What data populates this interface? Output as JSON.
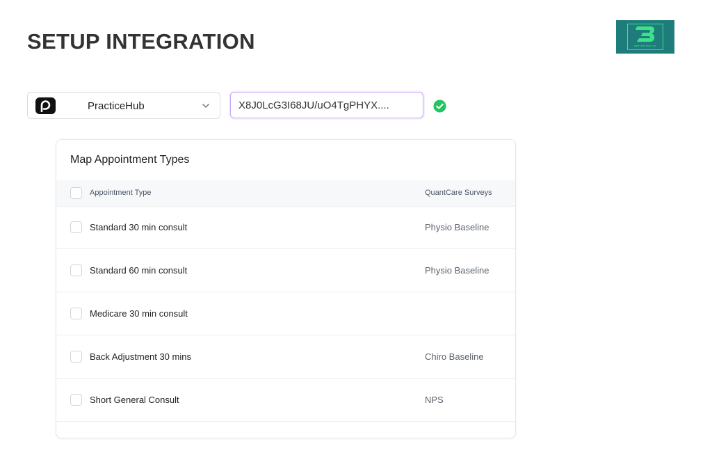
{
  "page": {
    "title": "SETUP INTEGRATION"
  },
  "brand": {
    "logo_text": "BETTER HEALTH",
    "colors": {
      "background": "#1e7c7a",
      "accent": "#3ee08f"
    }
  },
  "integration": {
    "selected_source": "PracticeHub",
    "source_icon": "practicehub-logo-icon",
    "api_key_value": "X8J0LcG3I68JU/uO4TgPHYX....",
    "status_icon": "check-circle-icon",
    "status_color": "#22c55e",
    "input_focus_color": "#c9a7f5"
  },
  "mapping": {
    "title": "Map Appointment Types",
    "columns": {
      "appointment_type": "Appointment Type",
      "survey": "QuantCare Surveys"
    },
    "rows": [
      {
        "appointment_type": "Standard 30 min consult",
        "survey": "Physio Baseline"
      },
      {
        "appointment_type": "Standard 60 min consult",
        "survey": "Physio Baseline"
      },
      {
        "appointment_type": "Medicare 30 min consult",
        "survey": ""
      },
      {
        "appointment_type": "Back Adjustment 30 mins",
        "survey": "Chiro Baseline"
      },
      {
        "appointment_type": "Short General Consult",
        "survey": "NPS"
      }
    ]
  }
}
